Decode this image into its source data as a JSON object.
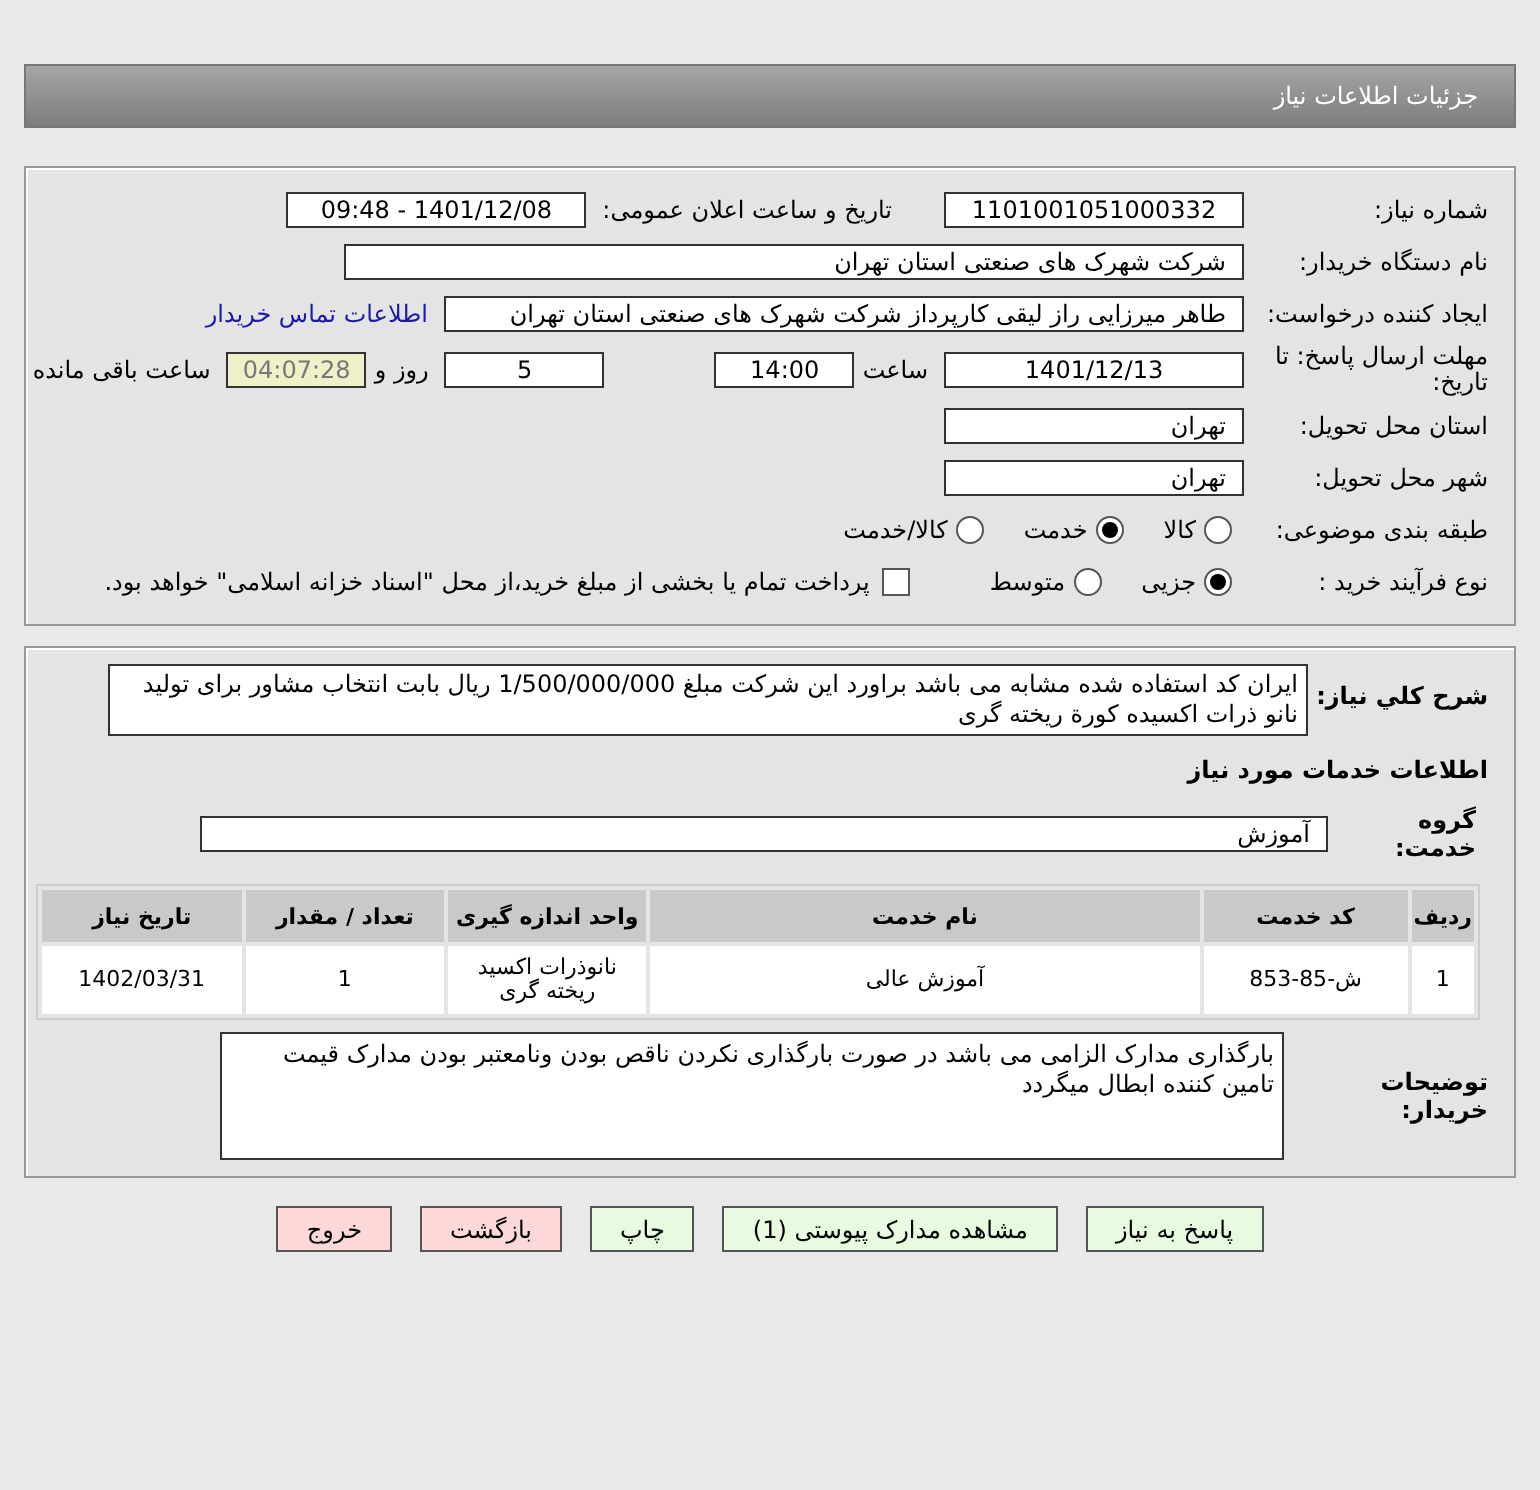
{
  "header": {
    "title": "جزئیات اطلاعات نیاز"
  },
  "need_number": {
    "label": "شماره نیاز:",
    "value": "1101001051000332"
  },
  "announce": {
    "label": "تاریخ و ساعت اعلان عمومی:",
    "value": "1401/12/08 - 09:48"
  },
  "buyer_org": {
    "label": "نام دستگاه خریدار:",
    "value": "شرکت شهرک های صنعتی استان تهران"
  },
  "requester": {
    "label": "ایجاد کننده درخواست:",
    "value": "طاهر  میرزایی راز لیقی کارپرداز شرکت شهرک های صنعتی استان تهران",
    "link": "اطلاعات تماس خریدار"
  },
  "deadline": {
    "label": "مهلت ارسال پاسخ: تا تاریخ:",
    "date": "1401/12/13",
    "time_label": "ساعت",
    "time": "14:00",
    "days": "5",
    "days_label": "روز و",
    "remaining": "04:07:28",
    "remaining_label": "ساعت باقی مانده"
  },
  "province": {
    "label": "استان محل تحویل:",
    "value": "تهران"
  },
  "city": {
    "label": "شهر محل تحویل:",
    "value": "تهران"
  },
  "category": {
    "label": "طبقه بندی موضوعی:",
    "options": [
      {
        "label": "کالا",
        "selected": false
      },
      {
        "label": "خدمت",
        "selected": true
      },
      {
        "label": "کالا/خدمت",
        "selected": false
      }
    ]
  },
  "process": {
    "label": "نوع فرآیند خرید :",
    "options": [
      {
        "label": "جزیی",
        "selected": true
      },
      {
        "label": "متوسط",
        "selected": false
      }
    ],
    "payment": {
      "label": "پرداخت تمام یا بخشی از مبلغ خرید،از محل \"اسناد خزانه اسلامی\" خواهد بود.",
      "checked": false
    }
  },
  "summary": {
    "label": "شرح کلي نياز:",
    "value": "ایران کد استفاده شده مشابه می باشد براورد این شرکت مبلغ 1/500/000/000 ریال بابت انتخاب مشاور برای تولید نانو ذرات اکسیده کورة ریخته گری"
  },
  "services_heading": "اطلاعات خدمات مورد نیاز",
  "service_group": {
    "label": "گروه خدمت:",
    "value": "آموزش"
  },
  "table": {
    "columns": [
      "ردیف",
      "کد خدمت",
      "نام خدمت",
      "واحد اندازه گیری",
      "تعداد / مقدار",
      "تاریخ نیاز"
    ],
    "rows": [
      [
        "1",
        "ش-85-853",
        "آموزش عالی",
        "نانوذرات اکسید ریخته گری",
        "1",
        "1402/03/31"
      ]
    ]
  },
  "buyer_notes": {
    "label": "توضیحات خریدار:",
    "value": "بارگذاری مدارک الزامی می باشد در صورت بارگذاری نکردن ناقص بودن  ونامعتبر بودن مدارک قیمت تامین کننده ابطال میگردد"
  },
  "buttons": [
    {
      "label": "پاسخ به نیاز",
      "kind": "normal"
    },
    {
      "label": "مشاهده مدارک پیوستی (1)",
      "kind": "normal"
    },
    {
      "label": "چاپ",
      "kind": "normal"
    },
    {
      "label": "بازگشت",
      "kind": "danger"
    },
    {
      "label": "خروج",
      "kind": "danger"
    }
  ]
}
